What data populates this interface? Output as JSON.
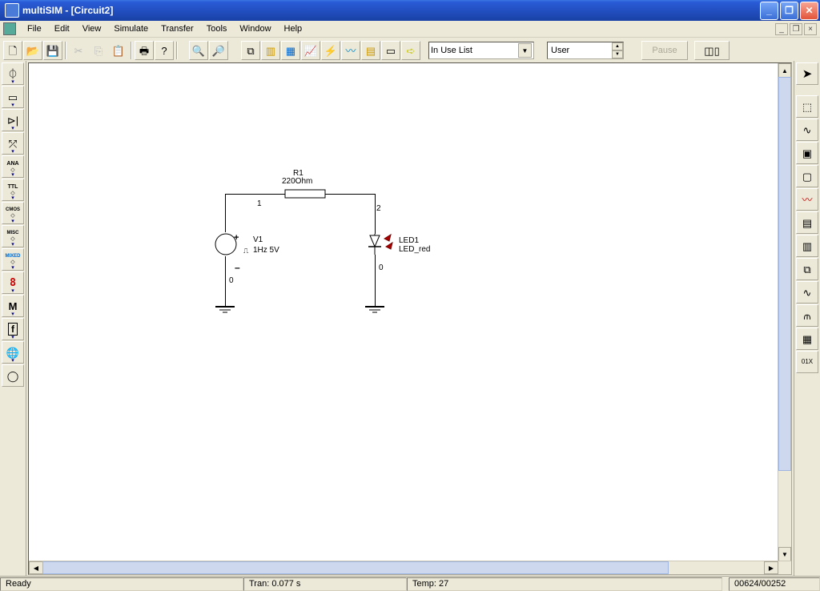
{
  "title": "multiSIM - [Circuit2]",
  "menus": [
    "File",
    "Edit",
    "View",
    "Simulate",
    "Transfer",
    "Tools",
    "Window",
    "Help"
  ],
  "toolbar": {
    "combo1": "In Use List",
    "user_field": "User",
    "pause": "Pause"
  },
  "left_palette": [
    {
      "name": "source",
      "label": ""
    },
    {
      "name": "resistor",
      "label": ""
    },
    {
      "name": "diode",
      "label": ""
    },
    {
      "name": "transistor",
      "label": ""
    },
    {
      "name": "analog",
      "label": "ANA"
    },
    {
      "name": "ttl",
      "label": "TTL"
    },
    {
      "name": "cmos",
      "label": "CMOS"
    },
    {
      "name": "misc",
      "label": "MISC"
    },
    {
      "name": "mixed",
      "label": "MIXED"
    },
    {
      "name": "display",
      "label": "8"
    },
    {
      "name": "m",
      "label": "M"
    },
    {
      "name": "f",
      "label": "f"
    },
    {
      "name": "net",
      "label": ""
    },
    {
      "name": "meter",
      "label": ""
    }
  ],
  "right_palette": [
    "cursor",
    "multimeter",
    "funcgen",
    "wattmeter",
    "scope",
    "bode",
    "logic-analyzer",
    "word-gen",
    "logic-conv",
    "network",
    "spectrum",
    "dist-analyzer",
    "iv"
  ],
  "circuit": {
    "r1": {
      "name": "R1",
      "value": "220Ohm"
    },
    "v1": {
      "name": "V1",
      "value": "1Hz 5V"
    },
    "led": {
      "name": "LED1",
      "model": "LED_red"
    },
    "nodes": {
      "n1": "1",
      "n2": "2",
      "n0a": "0",
      "n0b": "0"
    }
  },
  "status": {
    "ready": "Ready",
    "tran": "Tran: 0.077 s",
    "temp": "Temp: 27",
    "coords": "00624/00252"
  }
}
